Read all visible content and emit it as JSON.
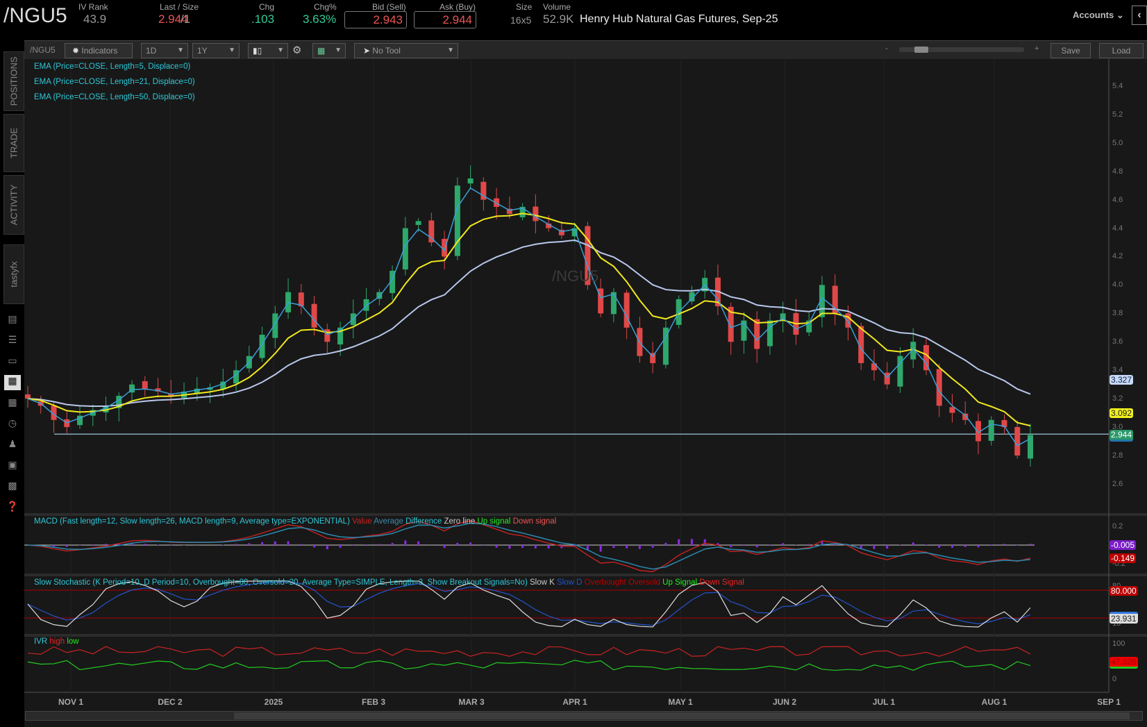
{
  "header": {
    "symbol": "/NGU5",
    "iv_rank_label": "IV Rank",
    "iv_rank": "43.9",
    "last_label": "Last / Size",
    "last": "2.944",
    "last_size": "/1",
    "chg_label": "Chg",
    "chg": ".103",
    "chgpct_label": "Chg%",
    "chgpct": "3.63%",
    "bid_label": "Bid (Sell)",
    "bid": "2.943",
    "ask_label": "Ask (Buy)",
    "ask": "2.944",
    "size_label": "Size",
    "size": "16x5",
    "volume_label": "Volume",
    "volume": "52.9K",
    "description": "Henry Hub Natural Gas Futures, Sep-25",
    "accounts": "Accounts"
  },
  "toolbar": {
    "symbol": "/NGU5",
    "indicators": "Indicators",
    "interval": "1D",
    "range": "1Y",
    "tool": "No Tool",
    "zoom_minus": "-",
    "zoom_plus": "+",
    "save": "Save",
    "load": "Load"
  },
  "sidebar": {
    "tabs": [
      "POSITIONS",
      "TRADE",
      "ACTIVITY",
      "tastyfx"
    ]
  },
  "studies": {
    "ema": [
      "EMA (Price=CLOSE, Length=5, Displace=0)",
      "EMA (Price=CLOSE, Length=21, Displace=0)",
      "EMA (Price=CLOSE, Length=50, Displace=0)"
    ],
    "macd": {
      "title": "MACD (Fast length=12, Slow length=26, MACD length=9, Average type=EXPONENTIAL)",
      "value": "Value",
      "average": "Average",
      "difference": "Difference",
      "zero": "Zero line",
      "up": "Up signal",
      "down": "Down signal"
    },
    "stoch": {
      "title": "Slow Stochastic (K Period=10, D Period=10, Overbought=80, Oversold=20, Average Type=SIMPLE, Length=3, Show Breakout Signals=No)",
      "k": "Slow K",
      "d": "Slow D",
      "ob": "Overbought",
      "os": "Oversold",
      "up": "Up Signal",
      "down": "Down Signal"
    },
    "ivr": {
      "title": "IVR",
      "high": "high",
      "low": "low"
    }
  },
  "watermark": "/NGU5",
  "axes": {
    "price_ticks": [
      "5.4",
      "5.2",
      "5.0",
      "4.8",
      "4.6",
      "4.4",
      "4.2",
      "4.0",
      "3.8",
      "3.6",
      "3.4",
      "3.2",
      "3.0",
      "2.8",
      "2.6"
    ],
    "macd_ticks": [
      "0.2",
      "-0.2"
    ],
    "stoch_ticks": [
      "80",
      "10"
    ],
    "ivr_ticks": [
      "100",
      "0"
    ],
    "dates": [
      "NOV 1",
      "DEC 2",
      "2025",
      "FEB 3",
      "MAR 3",
      "APR 1",
      "MAY 1",
      "JUN 2",
      "JUL 1",
      "AUG 1",
      "SEP 1"
    ]
  },
  "badges": {
    "ema50": "3.327",
    "ema21": "3.092",
    "last": "2.944",
    "macd_diff": "-0.005",
    "macd_val": "-0.149",
    "stoch_ob": "80.000",
    "stoch_k": "23.931",
    "ivr": "47.828"
  },
  "colors": {
    "up": "#2ea86b",
    "down": "#e04848",
    "ema5": "#3aa0d8",
    "ema21": "#f0e81e",
    "ema50": "#b8c8ec",
    "study_text": "#2fc8d8"
  },
  "chart_data": {
    "type": "candlestick",
    "ylim": [
      2.5,
      5.5
    ],
    "support_level": 2.95,
    "closes": [
      3.2,
      3.15,
      3.05,
      3.0,
      3.08,
      3.12,
      3.15,
      3.22,
      3.3,
      3.27,
      3.25,
      3.22,
      3.25,
      3.27,
      3.28,
      3.32,
      3.4,
      3.5,
      3.65,
      3.8,
      3.95,
      3.85,
      3.7,
      3.6,
      3.7,
      3.8,
      3.9,
      3.95,
      4.1,
      4.4,
      4.45,
      4.3,
      4.2,
      4.7,
      4.75,
      4.6,
      4.55,
      4.5,
      4.55,
      4.45,
      4.4,
      4.35,
      4.4,
      4.0,
      3.8,
      3.95,
      3.7,
      3.5,
      3.45,
      3.7,
      3.9,
      3.95,
      4.05,
      3.85,
      3.6,
      3.75,
      3.55,
      3.75,
      3.8,
      3.65,
      3.75,
      4.0,
      3.8,
      3.7,
      3.45,
      3.4,
      3.3,
      3.5,
      3.6,
      3.4,
      3.15,
      3.1,
      3.05,
      2.9,
      3.05,
      3.0,
      2.8,
      2.944
    ]
  }
}
